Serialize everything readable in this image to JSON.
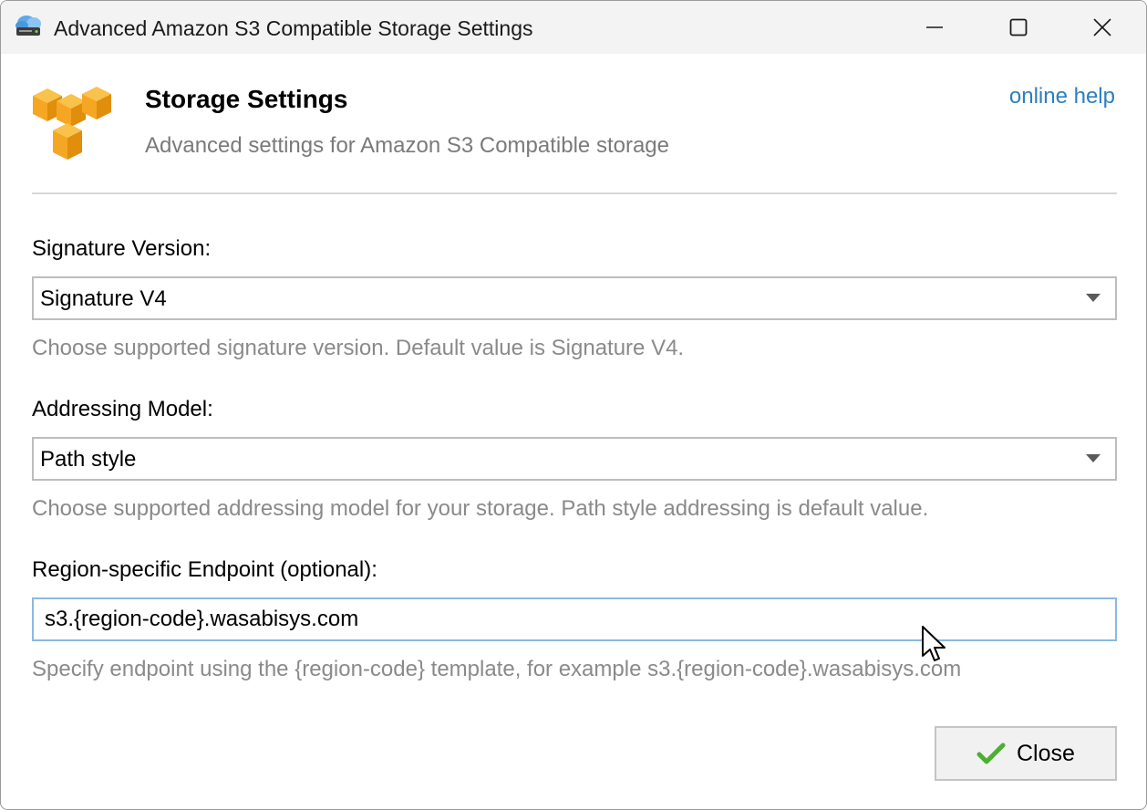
{
  "window": {
    "title": "Advanced Amazon S3 Compatible Storage Settings",
    "app_icon": "cloud-drive-icon",
    "controls": {
      "minimize": "minimize-icon",
      "maximize": "maximize-icon",
      "close": "close-icon"
    }
  },
  "header": {
    "logo": "aws-boxes-logo",
    "title": "Storage Settings",
    "subtitle": "Advanced settings for Amazon S3 Compatible storage",
    "help_link": "online help"
  },
  "signature": {
    "label": "Signature Version:",
    "selected": "Signature V4",
    "hint": "Choose supported signature version. Default value is Signature V4."
  },
  "addressing": {
    "label": "Addressing Model:",
    "selected": "Path style",
    "hint": "Choose supported addressing model for your storage. Path style addressing is default value."
  },
  "endpoint": {
    "label": "Region-specific Endpoint (optional):",
    "value": "s3.{region-code}.wasabisys.com",
    "hint": "Specify endpoint using the {region-code} template, for example s3.{region-code}.wasabisys.com"
  },
  "footer": {
    "close_label": "Close",
    "close_icon": "checkmark-icon"
  },
  "colors": {
    "link": "#2a7fc4",
    "hint_text": "#8a8a8a",
    "focus_border": "#8cb8e3",
    "logo_orange": "#f5a623",
    "check_green": "#4caf32"
  }
}
